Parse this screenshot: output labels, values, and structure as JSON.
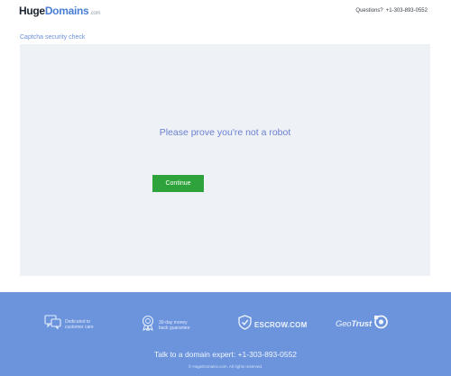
{
  "header": {
    "logo_huge": "Huge",
    "logo_domains": "Domains",
    "logo_com": ".com",
    "questions_label": "Questions?",
    "phone": "+1-303-893-0552"
  },
  "breadcrumb": "Captcha security check",
  "captcha": {
    "prompt": "Please prove you're not a robot",
    "continue_label": "Continue"
  },
  "footer": {
    "badges": [
      {
        "icon": "customer-care-icon",
        "line1": "Dedicated to",
        "line2": "customer care"
      },
      {
        "icon": "money-back-medal-icon",
        "line1": "30-day money",
        "line2": "back guarantee"
      },
      {
        "icon": "escrow-shield-icon",
        "text": "ESCROW.COM"
      },
      {
        "icon": "geotrust-seal-icon",
        "geo": "Geo",
        "trust": "Trust"
      }
    ],
    "expert": "Talk to a domain expert: +1-303-893-0552",
    "copyright": "© HugeDomains.com. All rights reserved."
  },
  "colors": {
    "accent": "#4a7fd6",
    "footer_bg": "#6b94dd",
    "button_bg": "#2fa33b",
    "card_bg": "#eef2f7"
  }
}
